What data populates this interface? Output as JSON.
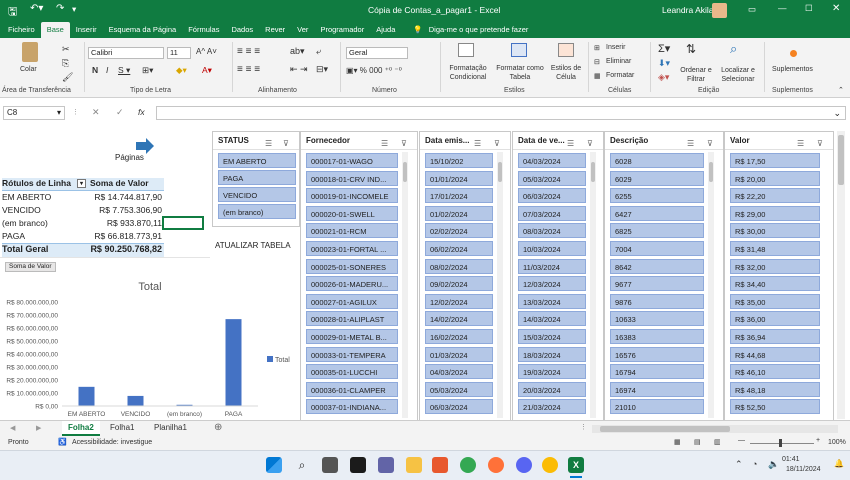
{
  "window": {
    "title": "Cópia de Contas_a_pagar1  -  Excel",
    "user": "Leandra Akila"
  },
  "tabs": [
    "Ficheiro",
    "Base",
    "Inserir",
    "Esquema da Página",
    "Fórmulas",
    "Dados",
    "Rever",
    "Ver",
    "Programador",
    "Ajuda"
  ],
  "tell_me": "Diga-me o que pretende fazer",
  "ribbon": {
    "paste": "Colar",
    "clipboard": "Área de Transferência",
    "font_name": "Calibri",
    "font_size": "11",
    "font_group": "Tipo de Letra",
    "align_group": "Alinhamento",
    "number_format": "Geral",
    "number_group": "Número",
    "cond_format": "Formatação Condicional",
    "format_table": "Formatar como Tabela",
    "cell_styles": "Estilos de Célula",
    "styles_group": "Estilos",
    "insert": "Inserir",
    "delete": "Eliminar",
    "format": "Formatar",
    "cells_group": "Células",
    "sort_filter": "Ordenar e Filtrar",
    "find_select": "Localizar e Selecionar",
    "editing_group": "Edição",
    "addins": "Suplementos",
    "addins_group": "Suplementos"
  },
  "formula_bar": {
    "namebox": "C8",
    "fx": "fx",
    "value": ""
  },
  "nav_button": "Páginas",
  "pivot": {
    "header_label": "Rótulos de Linha",
    "header_value": "Soma de Valor",
    "rows": [
      {
        "label": "EM ABERTO",
        "value": "R$ 14.744.817,90"
      },
      {
        "label": "VENCIDO",
        "value": "R$ 7.753.306,90"
      },
      {
        "label": "(em branco)",
        "value": "R$ 933.870,11"
      },
      {
        "label": "PAGA",
        "value": "R$ 66.818.773,91"
      }
    ],
    "total_label": "Total Geral",
    "total_value": "R$ 90.250.768,82"
  },
  "atualizar": "ATUALIZAR TABELA",
  "chart_button": "Soma de Valor",
  "chart_data": {
    "type": "bar",
    "title": "Total",
    "categories": [
      "EM ABERTO",
      "VENCIDO",
      "(em branco)",
      "PAGA"
    ],
    "series": [
      {
        "name": "Total",
        "values": [
          14744817.9,
          7753306.9,
          933870.11,
          66818773.91
        ]
      }
    ],
    "ylim": [
      0,
      80000000
    ],
    "yticks": [
      "R$ 0,00",
      "R$ 10.000.000,00",
      "R$ 20.000.000,00",
      "R$ 30.000.000,00",
      "R$ 40.000.000,00",
      "R$ 50.000.000,00",
      "R$ 60.000.000,00",
      "R$ 70.000.000,00",
      "R$ 80.000.000,00"
    ],
    "legend": "right",
    "color": "#4472c4"
  },
  "slicers": {
    "status": {
      "title": "STATUS",
      "items": [
        "EM ABERTO",
        "PAGA",
        "VENCIDO",
        "(em branco)"
      ]
    },
    "fornecedor": {
      "title": "Fornecedor",
      "items": [
        "000017-01-WAGO",
        "000018-01-CRV IND...",
        "000019-01-INCOMELE",
        "000020-01-SWELL",
        "000021-01-RCM",
        "000023-01-FORTAL ...",
        "000025-01-SONERES",
        "000026-01-MADERU...",
        "000027-01-AGILUX",
        "000028-01-ALIPLAST",
        "000029-01-METAL B...",
        "000033-01-TEMPERA",
        "000035-01-LUCCHI",
        "000036-01-CLAMPER",
        "000037-01-INDIANA..."
      ]
    },
    "emissao": {
      "title": "Data emis...",
      "items": [
        "15/10/202",
        "01/01/2024",
        "17/01/2024",
        "01/02/2024",
        "02/02/2024",
        "06/02/2024",
        "08/02/2024",
        "09/02/2024",
        "12/02/2024",
        "14/02/2024",
        "16/02/2024",
        "01/03/2024",
        "04/03/2024",
        "05/03/2024",
        "06/03/2024"
      ]
    },
    "vencimento": {
      "title": "Data de ve...",
      "items": [
        "04/03/2024",
        "05/03/2024",
        "06/03/2024",
        "07/03/2024",
        "08/03/2024",
        "10/03/2024",
        "11/03/2024",
        "12/03/2024",
        "13/03/2024",
        "14/03/2024",
        "15/03/2024",
        "18/03/2024",
        "19/03/2024",
        "20/03/2024",
        "21/03/2024"
      ]
    },
    "descricao": {
      "title": "Descrição",
      "items": [
        "6028",
        "6029",
        "6255",
        "6427",
        "6825",
        "7004",
        "8642",
        "9677",
        "9876",
        "10633",
        "16383",
        "16576",
        "16794",
        "16974",
        "21010"
      ]
    },
    "valor": {
      "title": "Valor",
      "items": [
        "R$ 17,50",
        "R$ 20,00",
        "R$ 22,20",
        "R$ 29,00",
        "R$ 30,00",
        "R$ 31,48",
        "R$ 32,00",
        "R$ 34,40",
        "R$ 35,00",
        "R$ 36,00",
        "R$ 36,94",
        "R$ 44,68",
        "R$ 46,10",
        "R$ 48,18",
        "R$ 52,50"
      ]
    }
  },
  "sheet_tabs": [
    "Folha2",
    "Folha1",
    "Planilha1"
  ],
  "status": {
    "ready": "Pronto",
    "accessibility": "Acessibilidade: investigue",
    "zoom": "100%"
  },
  "clock": {
    "time": "01:41",
    "date": "18/11/2024"
  }
}
